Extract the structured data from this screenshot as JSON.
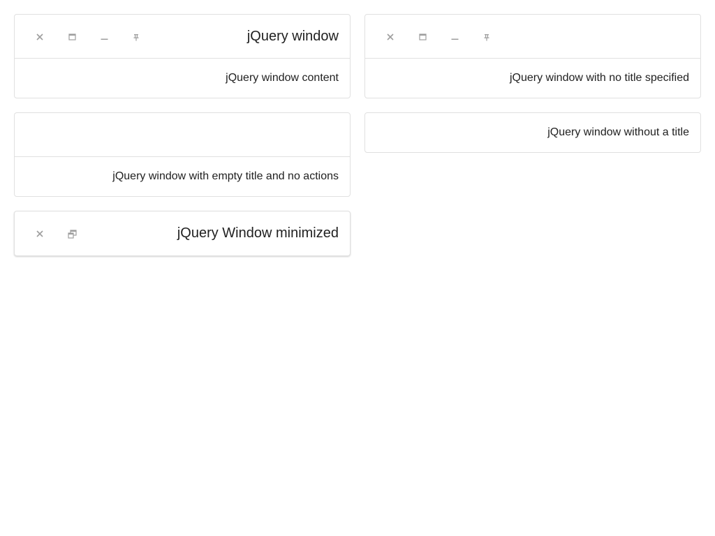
{
  "windows": [
    {
      "title": "jQuery window",
      "content": "jQuery window content",
      "actions": [
        "close-icon",
        "maximize-icon",
        "minimize-icon",
        "pin-icon"
      ]
    },
    {
      "title": "",
      "content": "jQuery window with no title specified",
      "actions": [
        "close-icon",
        "maximize-icon",
        "minimize-icon",
        "pin-icon"
      ]
    },
    {
      "title": "",
      "content": "jQuery window with empty title and no actions",
      "actions": []
    },
    {
      "content": "jQuery window without a title"
    },
    {
      "title": "jQuery Window minimized",
      "actions": [
        "close-icon",
        "restore-icon"
      ],
      "state": "minimized"
    }
  ],
  "colors": {
    "border": "#e0e0e0",
    "icon": "#9e9e9e",
    "text": "#212121"
  }
}
